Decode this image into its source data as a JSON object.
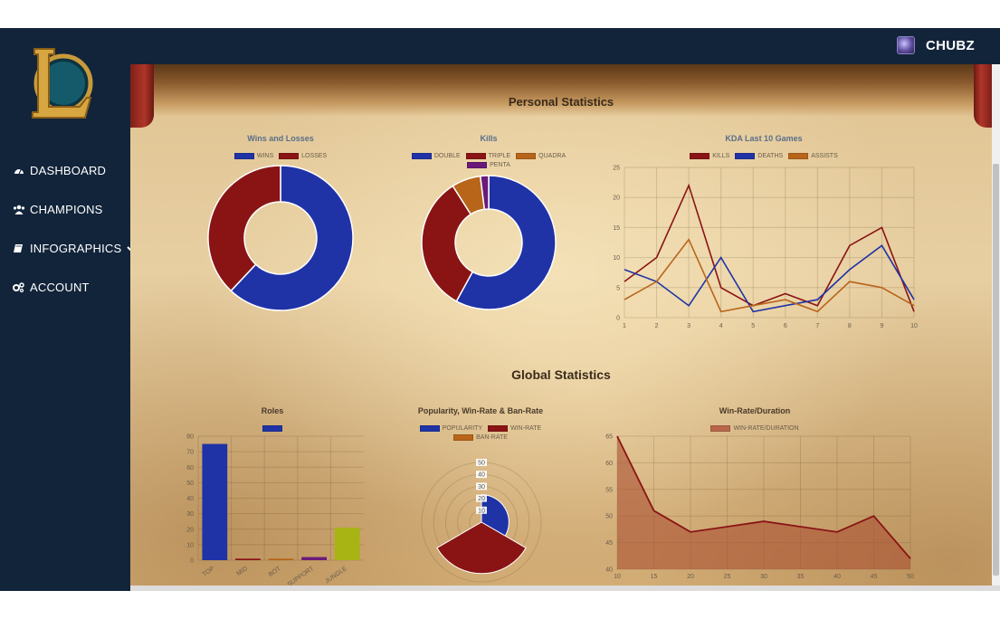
{
  "header": {
    "username": "CHUBZ"
  },
  "sidebar": {
    "items": [
      {
        "label": "DASHBOARD",
        "icon": "dashboard-icon"
      },
      {
        "label": "CHAMPIONS",
        "icon": "users-icon"
      },
      {
        "label": "INFOGRAPHICS",
        "icon": "book-icon"
      },
      {
        "label": "ACCOUNT",
        "icon": "gears-icon"
      }
    ]
  },
  "colors": {
    "blue": "#1f33a6",
    "darkred": "#8a1414",
    "orange": "#b8651a",
    "purple": "#6a1a7a",
    "olive": "#a8b414",
    "sidebar": "#12243a"
  },
  "sections": {
    "personal": "Personal Statistics",
    "global": "Global Statistics"
  },
  "chart_data": [
    {
      "type": "pie",
      "title": "Wins and Losses",
      "categories": [
        "WINS",
        "LOSSES"
      ],
      "values": [
        62,
        38
      ],
      "colors": [
        "#1f33a6",
        "#8a1414"
      ]
    },
    {
      "type": "pie",
      "title": "Kills",
      "categories": [
        "DOUBLE",
        "TRIPLE",
        "QUADRA",
        "PENTA"
      ],
      "values": [
        58,
        33,
        7,
        2
      ],
      "colors": [
        "#1f33a6",
        "#8a1414",
        "#b8651a",
        "#6a1a7a"
      ]
    },
    {
      "type": "line",
      "title": "KDA Last 10 Games",
      "x": [
        1,
        2,
        3,
        4,
        5,
        6,
        7,
        8,
        9,
        10
      ],
      "series": [
        {
          "name": "KILLS",
          "color": "#8a1414",
          "values": [
            6,
            10,
            22,
            5,
            2,
            4,
            2,
            12,
            15,
            1
          ]
        },
        {
          "name": "DEATHS",
          "color": "#1f33a6",
          "values": [
            8,
            6,
            2,
            10,
            1,
            2,
            3,
            8,
            12,
            3
          ]
        },
        {
          "name": "ASSISTS",
          "color": "#b8651a",
          "values": [
            3,
            6,
            13,
            1,
            2,
            3,
            1,
            6,
            5,
            2
          ]
        }
      ],
      "ylim": [
        0,
        25
      ],
      "yticks": [
        0,
        5,
        10,
        15,
        20,
        25
      ]
    },
    {
      "type": "bar",
      "title": "Roles",
      "categories": [
        "TOP",
        "MID",
        "BOT",
        "SUPPORT",
        "JUNGLE"
      ],
      "values": [
        75,
        1,
        1,
        2,
        21
      ],
      "colors": [
        "#1f33a6",
        "#8a1414",
        "#b8651a",
        "#6a1a7a",
        "#a8b414"
      ],
      "ylim": [
        0,
        80
      ],
      "yticks": [
        0,
        10,
        20,
        30,
        40,
        50,
        60,
        70,
        80
      ]
    },
    {
      "type": "pie",
      "title": "Popularity, Win-Rate & Ban-Rate",
      "categories": [
        "POPULARITY",
        "WIN-RATE",
        "BAN-RATE"
      ],
      "values": [
        23,
        43,
        0
      ],
      "colors": [
        "#1f33a6",
        "#8a1414",
        "#b8651a"
      ],
      "radial_ticks": [
        "50",
        "40",
        "30",
        "20",
        "10"
      ],
      "rlim": [
        0,
        50
      ]
    },
    {
      "type": "area",
      "title": "Win-Rate/Duration",
      "x": [
        10,
        15,
        20,
        25,
        30,
        35,
        40,
        45,
        50
      ],
      "series": [
        {
          "name": "WIN-RATE/DURATION",
          "color": "#8a1414",
          "values": [
            65,
            51,
            47,
            48,
            49,
            48,
            47,
            50,
            42
          ]
        }
      ],
      "ylim": [
        40,
        65
      ],
      "yticks": [
        40,
        45,
        50,
        55,
        60,
        65
      ]
    }
  ]
}
